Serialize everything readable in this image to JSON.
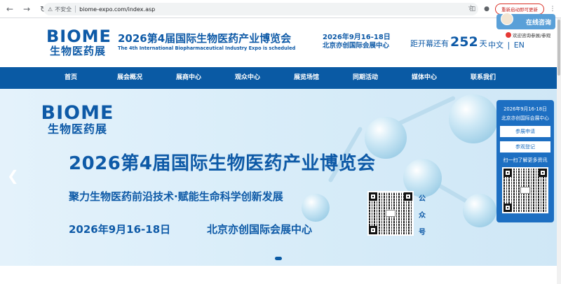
{
  "browser": {
    "back_icon": "back-arrow-icon",
    "forward_icon": "forward-arrow-icon",
    "reload_icon": "reload-icon",
    "security_label": "不安全",
    "url": "biome-expo.com/index.asp",
    "update_label": "重新启动即可更新"
  },
  "header": {
    "logo_en": "BIOME",
    "logo_cn": "生物医药展",
    "title_cn": "2026第4届国际生物医药产业博览会",
    "title_en": "The 4th International Biopharmaceutical Industry Expo is scheduled",
    "date": "2026年9月16-18日",
    "venue": "北京亦创国际会展中心",
    "countdown_label": "距开幕还有",
    "countdown_value": "252",
    "countdown_unit": "天",
    "lang_cn": "中文",
    "lang_sep": "|",
    "lang_en": "EN"
  },
  "nav": {
    "items": [
      {
        "label": "首页"
      },
      {
        "label": "展会概况"
      },
      {
        "label": "展商中心"
      },
      {
        "label": "观众中心"
      },
      {
        "label": "展览场馆"
      },
      {
        "label": "同期活动"
      },
      {
        "label": "媒体中心"
      },
      {
        "label": "联系我们"
      }
    ]
  },
  "banner": {
    "logo_en": "BIOME",
    "logo_cn": "生物医药展",
    "title": "2026第4届国际生物医药产业博览会",
    "subtitle": "聚力生物医药前沿技术·赋能生命科学创新发展",
    "date": "2026年9月16-18日",
    "venue": "北京亦创国际会展中心",
    "wechat_label": [
      "公",
      "众",
      "号"
    ]
  },
  "float": {
    "online_label": "在线咨询",
    "note": "欢迎咨询参展/参观"
  },
  "side_panel": {
    "date": "2026年9月16-18日",
    "venue": "北京亦创国际会展中心",
    "exhibit_button": "参展申请",
    "visit_button": "参观登记",
    "scan_label": "扫一扫了解更多资讯"
  },
  "colors": {
    "brand_blue": "#0e5aa7",
    "nav_blue": "#0a5aa4",
    "panel_blue": "#1d6fc2"
  }
}
